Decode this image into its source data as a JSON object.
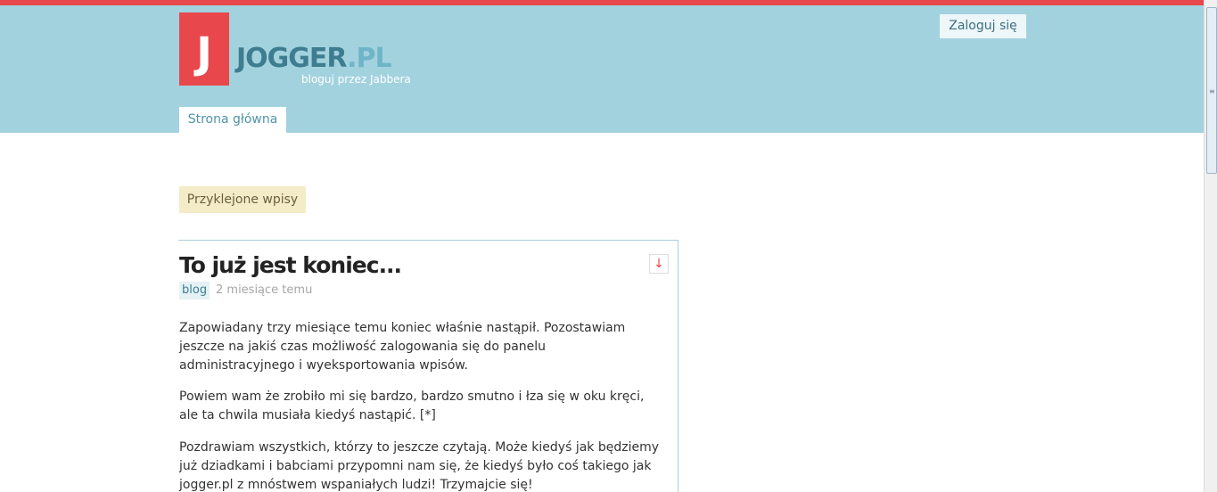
{
  "header": {
    "logo_letter": "J",
    "logo_main": "JOGGER",
    "logo_ext": ".PL",
    "tagline": "bloguj przez Jabbera",
    "login_label": "Zaloguj się"
  },
  "nav": {
    "tabs": [
      {
        "label": "Strona główna",
        "active": true
      }
    ]
  },
  "sticky_section": {
    "label": "Przyklejone wpisy"
  },
  "post": {
    "title": "To już jest koniec...",
    "expand_icon": "arrow-down-icon",
    "tag": "blog",
    "date": "2 miesiące temu",
    "paragraphs": [
      "Zapowiadany trzy miesiące temu koniec właśnie nastąpił. Pozostawiam jeszcze na jakiś czas możliwość zalogowania się do panelu administracyjnego i wyeksportowania wpisów.",
      "Powiem wam że zrobiło mi się bardzo, bardzo smutno i łza się w oku kręci, ale ta chwila musiała kiedyś nastąpić. [*]",
      "Pozdrawiam wszystkich, którzy to jeszcze czytają. Może kiedyś jak będziemy już dziadkami i babciami przypomni nam się, że kiedyś było coś takiego jak jogger.pl z mnóstwem wspaniałych ludzi! Trzymajcie się!"
    ]
  },
  "colors": {
    "accent_red": "#e8474c",
    "header_blue": "#a3d2df",
    "logo_text": "#3e7d8f",
    "sticky_bg": "#f4ecc7"
  }
}
